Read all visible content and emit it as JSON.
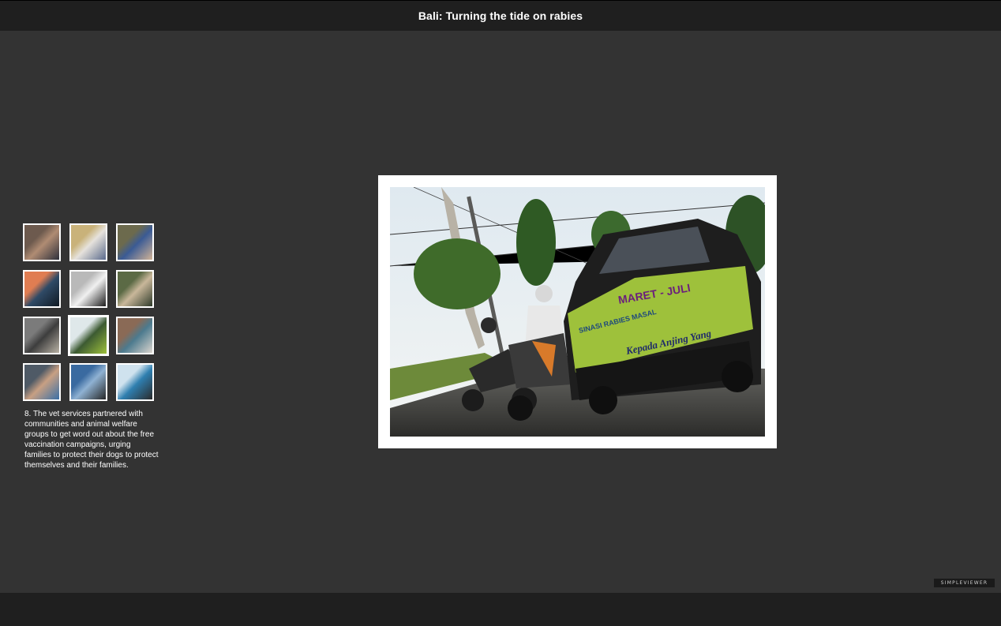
{
  "gallery": {
    "title": "Bali: Turning the tide on rabies",
    "selected_index": 8,
    "caption": "8. The vet services partnered with communities and animal welfare groups to get word out about the free vaccination campaigns, urging families to protect their dogs to protect themselves and their families.",
    "thumbnails": [
      {
        "name": "thumb-1",
        "colors": [
          "#6d5a4e",
          "#b08c73",
          "#2d2f3a"
        ]
      },
      {
        "name": "thumb-2",
        "colors": [
          "#c9b27a",
          "#e6e2dc",
          "#5a6a8c"
        ]
      },
      {
        "name": "thumb-3",
        "colors": [
          "#6c6a4d",
          "#3b5b95",
          "#d2b497"
        ]
      },
      {
        "name": "thumb-4",
        "colors": [
          "#e07d52",
          "#2f4a66",
          "#111a24"
        ]
      },
      {
        "name": "thumb-5",
        "colors": [
          "#b9b9b9",
          "#f0f0f0",
          "#1c1c1c"
        ]
      },
      {
        "name": "thumb-6",
        "colors": [
          "#5b6a45",
          "#c9b79a",
          "#2e3a2a"
        ]
      },
      {
        "name": "thumb-7",
        "colors": [
          "#7b7b7b",
          "#3d3d3d",
          "#b9b2a5"
        ]
      },
      {
        "name": "thumb-8",
        "colors": [
          "#dfe8ea",
          "#3c5a32",
          "#9ec13b"
        ]
      },
      {
        "name": "thumb-9",
        "colors": [
          "#8a6a56",
          "#4c7a8e",
          "#dcd6cf"
        ]
      },
      {
        "name": "thumb-10",
        "colors": [
          "#4f5a66",
          "#c8a083",
          "#3a6fa6"
        ]
      },
      {
        "name": "thumb-11",
        "colors": [
          "#3a6aa0",
          "#8fb2d3",
          "#262626"
        ]
      },
      {
        "name": "thumb-12",
        "colors": [
          "#cfe2ee",
          "#2f7fb0",
          "#2a2a2a"
        ]
      }
    ],
    "main_photo": {
      "banner_lines": [
        "MARET - JULI",
        "SINASI RABIES MASAL",
        "Kepada Anjing Yang"
      ],
      "accent": "#9ec13b"
    }
  },
  "branding": {
    "simpleviewer_label": "SIMPLEVIEWER"
  }
}
